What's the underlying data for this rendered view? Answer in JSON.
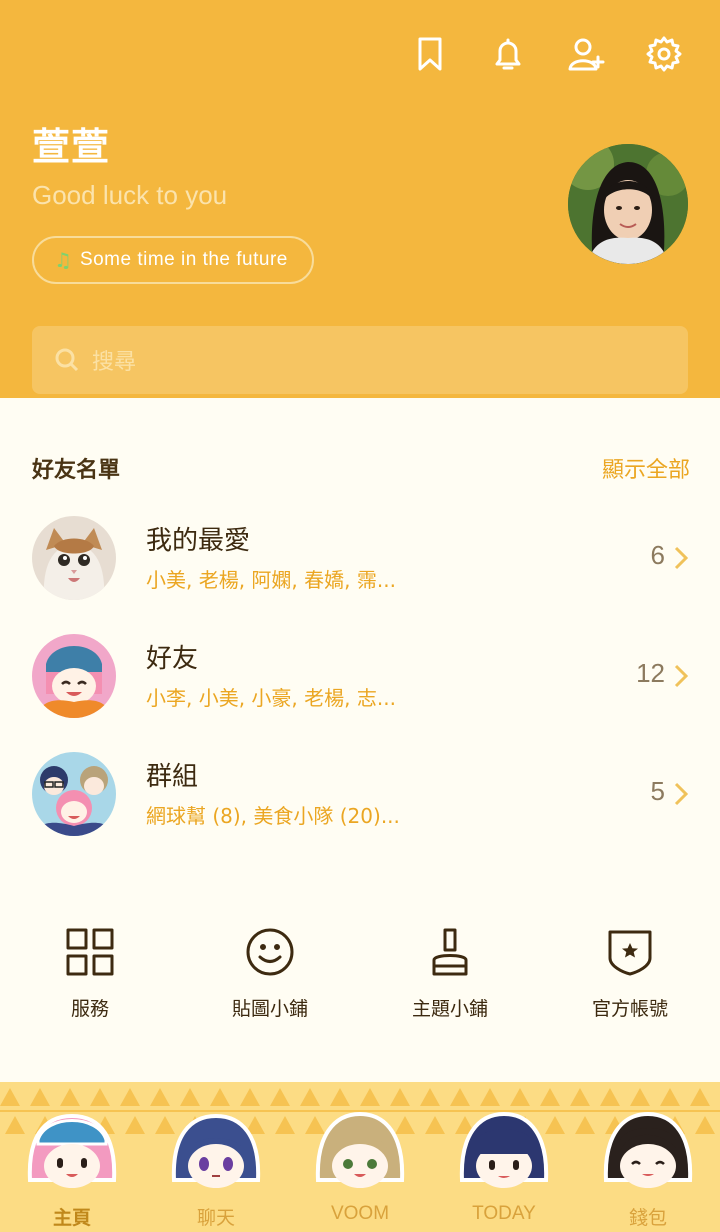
{
  "header": {
    "icons": [
      "bookmark-icon",
      "bell-icon",
      "add-friend-icon",
      "settings-icon"
    ],
    "name": "萱萱",
    "status_message": "Good luck to you",
    "music": "Some time in the future",
    "search_placeholder": "搜尋"
  },
  "friends": {
    "title": "好友名單",
    "show_all": "顯示全部",
    "rows": [
      {
        "title": "我的最愛",
        "sub": "小美, 老楊, 阿嫻, 春嬌, 霈...",
        "count": "6"
      },
      {
        "title": "好友",
        "sub": "小李, 小美, 小豪, 老楊, 志...",
        "count": "12"
      },
      {
        "title": "群組",
        "sub": "網球幫 (8), 美食小隊 (20)...",
        "count": "5"
      }
    ]
  },
  "shortcuts": [
    {
      "label": "服務",
      "icon": "grid-icon"
    },
    {
      "label": "貼圖小鋪",
      "icon": "smiley-icon"
    },
    {
      "label": "主題小鋪",
      "icon": "brush-icon"
    },
    {
      "label": "官方帳號",
      "icon": "shield-star-icon"
    }
  ],
  "nav": [
    {
      "label": "主頁",
      "active": true
    },
    {
      "label": "聊天"
    },
    {
      "label": "VOOM"
    },
    {
      "label": "TODAY"
    },
    {
      "label": "錢包"
    }
  ],
  "colors": {
    "header": "#f4b73e",
    "accent": "#eba622",
    "text": "#3d2a10",
    "bg": "#fffdf3"
  }
}
